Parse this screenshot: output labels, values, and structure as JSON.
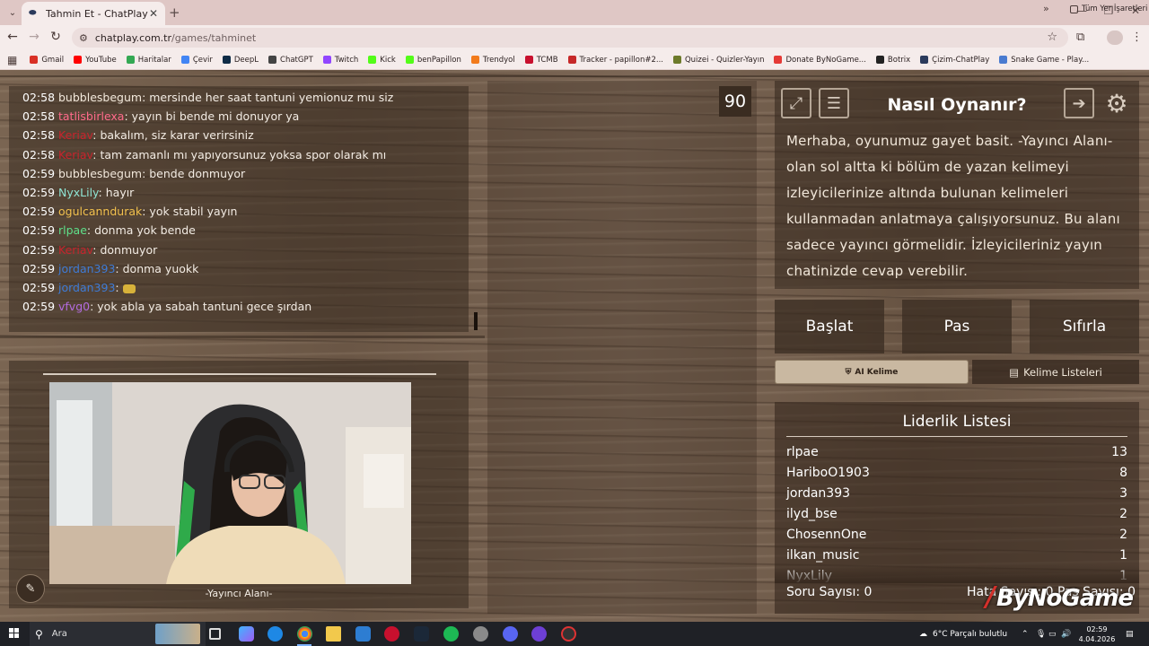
{
  "browser": {
    "tab_title": "Tahmin Et - ChatPlay",
    "url_host": "chatplay.com.tr",
    "url_path": "/games/tahminet",
    "bookmarks": [
      {
        "label": "Gmail",
        "color": "#d93025"
      },
      {
        "label": "YouTube",
        "color": "#ff0000"
      },
      {
        "label": "Haritalar",
        "color": "#34a853"
      },
      {
        "label": "Çevir",
        "color": "#4285f4"
      },
      {
        "label": "DeepL",
        "color": "#0f2b46"
      },
      {
        "label": "ChatGPT",
        "color": "#444444"
      },
      {
        "label": "Twitch",
        "color": "#9146ff"
      },
      {
        "label": "Kick",
        "color": "#53fc18"
      },
      {
        "label": "benPapillon",
        "color": "#53fc18"
      },
      {
        "label": "Trendyol",
        "color": "#f27a1a"
      },
      {
        "label": "TCMB",
        "color": "#c8102e"
      },
      {
        "label": "Tracker - papillon#2...",
        "color": "#c62828"
      },
      {
        "label": "Quizei - Quizler-Yayın",
        "color": "#6d7a2a"
      },
      {
        "label": "Donate ByNoGame...",
        "color": "#e53935"
      },
      {
        "label": "Botrix",
        "color": "#222222"
      },
      {
        "label": "Çizim-ChatPlay",
        "color": "#2b3a5c"
      },
      {
        "label": "Snake Game - Play...",
        "color": "#4a7bd0"
      }
    ],
    "all_bookmarks": "Tüm Yer İşaretleri"
  },
  "chat": {
    "messages": [
      {
        "time": "02:58",
        "user": "bubblesbegum",
        "color": "#f3e9dc",
        "text": ": mersinde her saat tantuni yemionuz mu siz"
      },
      {
        "time": "02:58",
        "user": "tatlisbirlexa",
        "color": "#ff6b8b",
        "text": ": yayın bi bende mi donuyor ya"
      },
      {
        "time": "02:58",
        "user": "Keriav",
        "color": "#c8232c",
        "text": ": bakalım, siz karar verirsiniz"
      },
      {
        "time": "02:58",
        "user": "Keriav",
        "color": "#c8232c",
        "text": ": tam zamanlı mı yapıyorsunuz yoksa spor olarak mı"
      },
      {
        "time": "02:59",
        "user": "bubblesbegum",
        "color": "#f3e9dc",
        "text": ": bende donmuyor"
      },
      {
        "time": "02:59",
        "user": "NyxLily",
        "color": "#8fe3d2",
        "text": ": hayır"
      },
      {
        "time": "02:59",
        "user": "ogulcanndurak",
        "color": "#f2c14e",
        "text": ": yok stabil yayın"
      },
      {
        "time": "02:59",
        "user": "rlpae",
        "color": "#5fe08a",
        "text": ": donma yok bende"
      },
      {
        "time": "02:59",
        "user": "Keriav",
        "color": "#c8232c",
        "text": ": donmuyor"
      },
      {
        "time": "02:59",
        "user": "jordan393",
        "color": "#3e7bd6",
        "text": ": donma yuokk"
      },
      {
        "time": "02:59",
        "user": "jordan393",
        "color": "#3e7bd6",
        "text": ":"
      },
      {
        "time": "02:59",
        "user": "vfvg0",
        "color": "#b36be0",
        "text": ": yok abla ya sabah tantuni gece şırdan"
      }
    ]
  },
  "streamer": {
    "label": "-Yayıncı Alanı-"
  },
  "board": {
    "timer": "90"
  },
  "help": {
    "title": "Nasıl Oynanır?",
    "text": "Merhaba, oyunumuz gayet basit. -Yayıncı Alanı- olan sol altta ki bölüm de yazan kelimeyi izleyicilerinize altında bulunan kelimeleri kullanmadan anlatmaya çalışıyorsunuz. Bu alanı sadece yayıncı görmelidir. İzleyicileriniz yayın chatinizde cevap verebilir."
  },
  "actions": {
    "start": "Başlat",
    "pass": "Pas",
    "reset": "Sıfırla",
    "ai_word": "AI Kelime",
    "word_lists": "Kelime Listeleri"
  },
  "leaderboard": {
    "title": "Liderlik Listesi",
    "rows": [
      {
        "name": "rlpae",
        "score": "13"
      },
      {
        "name": "HariboO1903",
        "score": "8"
      },
      {
        "name": "jordan393",
        "score": "3"
      },
      {
        "name": "ilyd_bse",
        "score": "2"
      },
      {
        "name": "ChosennOne",
        "score": "2"
      },
      {
        "name": "ilkan_music",
        "score": "1"
      },
      {
        "name": "NyxLily",
        "score": "1"
      }
    ],
    "question_count": "Soru Sayısı: 0",
    "errors_pass": "Hata Sayısı: 0  Pas Sayısı: 0"
  },
  "watermark": "ByNoGame",
  "taskbar": {
    "search": "Ara",
    "weather": "6°C  Parçalı bulutlu",
    "time": "02:59",
    "date": "4.04.2026"
  }
}
